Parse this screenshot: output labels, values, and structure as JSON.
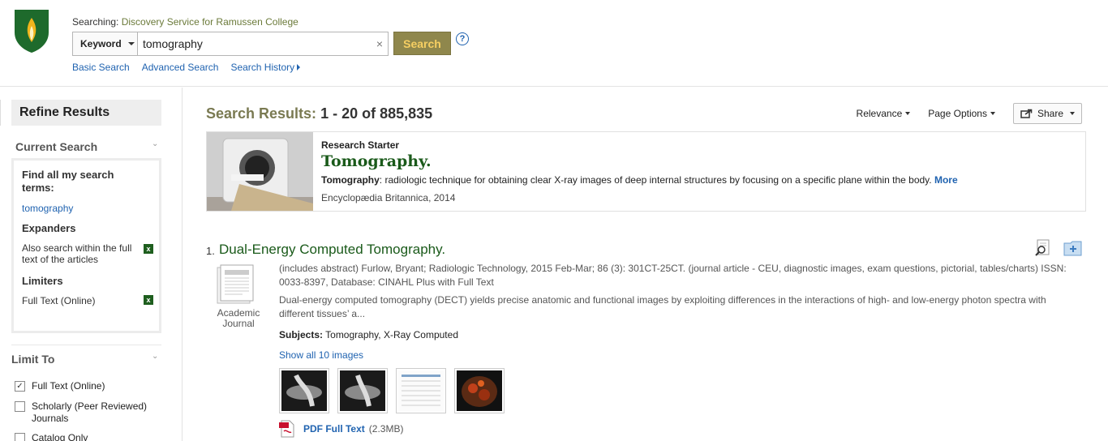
{
  "header": {
    "searching_label": "Searching:",
    "source": "Discovery Service for Ramussen College",
    "field_select": "Keyword",
    "query": "tomography",
    "search_button": "Search",
    "help": "?",
    "links": [
      "Basic Search",
      "Advanced Search",
      "Search History"
    ]
  },
  "sidebar": {
    "refine_title": "Refine Results",
    "current_search_heading": "Current Search",
    "find_all_heading": "Find all my search terms:",
    "term": "tomography",
    "expanders_heading": "Expanders",
    "expander_item": "Also search within the full text of the articles",
    "limiters_heading": "Limiters",
    "limiter_item": "Full Text (Online)",
    "limit_to_heading": "Limit To",
    "limit_options": [
      {
        "label": "Full Text (Online)",
        "checked": true
      },
      {
        "label": "Scholarly (Peer Reviewed) Journals",
        "checked": false
      },
      {
        "label": "Catalog Only",
        "checked": false
      }
    ]
  },
  "results": {
    "heading_label": "Search Results:",
    "heading_count": "1 - 20 of 885,835",
    "sort": "Relevance",
    "page_options": "Page Options",
    "share": "Share"
  },
  "research_starter": {
    "label": "Research Starter",
    "title": "Tomography.",
    "term": "Tomography",
    "description": ": radiologic technique for obtaining clear X-ray images of deep internal structures by focusing on a specific plane within the body.",
    "more": "More",
    "citation": "Encyclopædia Britannica, 2014"
  },
  "result1": {
    "number": "1.",
    "title": "Dual-Energy Computed Tomography.",
    "pub_type": "Academic Journal",
    "meta": "(includes abstract) Furlow, Bryant; Radiologic Technology, 2015 Feb-Mar; 86 (3): 301CT-25CT. (journal article - CEU, diagnostic images, exam questions, pictorial, tables/charts) ISSN: 0033-8397, Database: CINAHL Plus with Full Text",
    "abstract": "Dual-energy computed tomography (DECT) yields precise anatomic and functional images by exploiting differences in the interactions of high- and low-energy photon spectra with different tissues’ a...",
    "subjects_label": "Subjects:",
    "subjects": "Tomography, X-Ray Computed",
    "show_images": "Show all 10 images",
    "pdf_label": "PDF Full Text",
    "pdf_size": "(2.3MB)"
  },
  "colors": {
    "link": "#2063b0",
    "title_green": "#1a5a1a",
    "search_button_bg": "#8f874c",
    "search_button_text": "#f6cf62"
  }
}
